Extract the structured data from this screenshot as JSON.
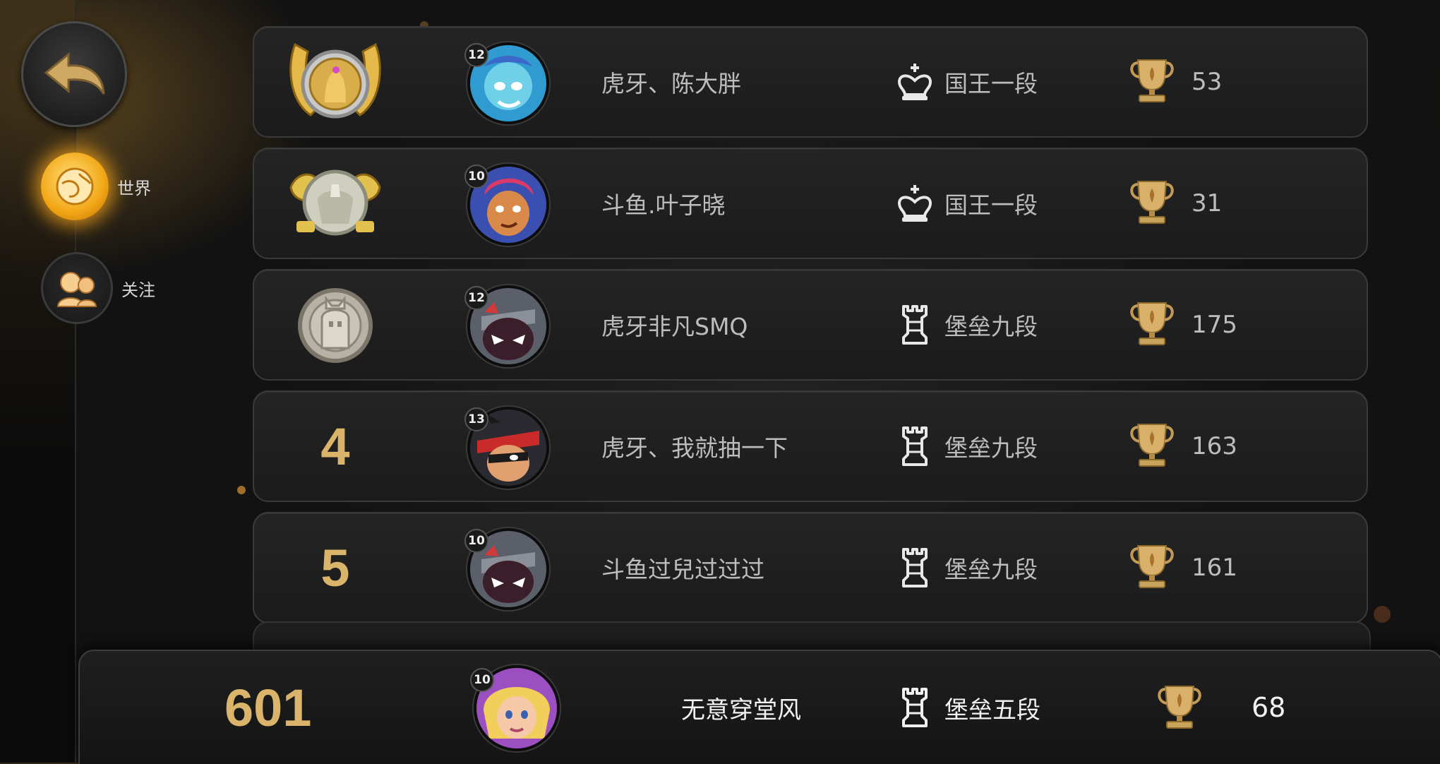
{
  "nav": {
    "back_icon": "back-arrow-icon",
    "items": [
      {
        "label": "世界",
        "icon": "globe-icon",
        "active": true
      },
      {
        "label": "关注",
        "icon": "friends-icon",
        "active": false
      }
    ]
  },
  "leaderboard": {
    "rows": [
      {
        "rank": "1",
        "rank_icon": "gold-rank-badge-icon",
        "level": "12",
        "name": "虎牙、陈大胖",
        "tier_icon": "king-icon",
        "tier": "国王一段",
        "trophies": "53"
      },
      {
        "rank": "2",
        "rank_icon": "silver-rank-badge-icon",
        "level": "10",
        "name": "斗鱼.叶子晓",
        "tier_icon": "king-icon",
        "tier": "国王一段",
        "trophies": "31"
      },
      {
        "rank": "3",
        "rank_icon": "bronze-rank-badge-icon",
        "level": "12",
        "name": "虎牙非凡SMQ",
        "tier_icon": "rook-icon",
        "tier": "堡垒九段",
        "trophies": "175"
      },
      {
        "rank": "4",
        "level": "13",
        "name": "虎牙、我就抽一下",
        "tier_icon": "rook-icon",
        "tier": "堡垒九段",
        "trophies": "163"
      },
      {
        "rank": "5",
        "level": "10",
        "name": "斗鱼过兒过过过",
        "tier_icon": "rook-icon",
        "tier": "堡垒九段",
        "trophies": "161"
      }
    ]
  },
  "self": {
    "rank": "601",
    "level": "10",
    "name": "无意穿堂风",
    "tier_icon": "rook-icon",
    "tier": "堡垒五段",
    "trophies": "68"
  },
  "colors": {
    "accent_gold": "#d9b46a",
    "active_nav": "#f2a615"
  }
}
